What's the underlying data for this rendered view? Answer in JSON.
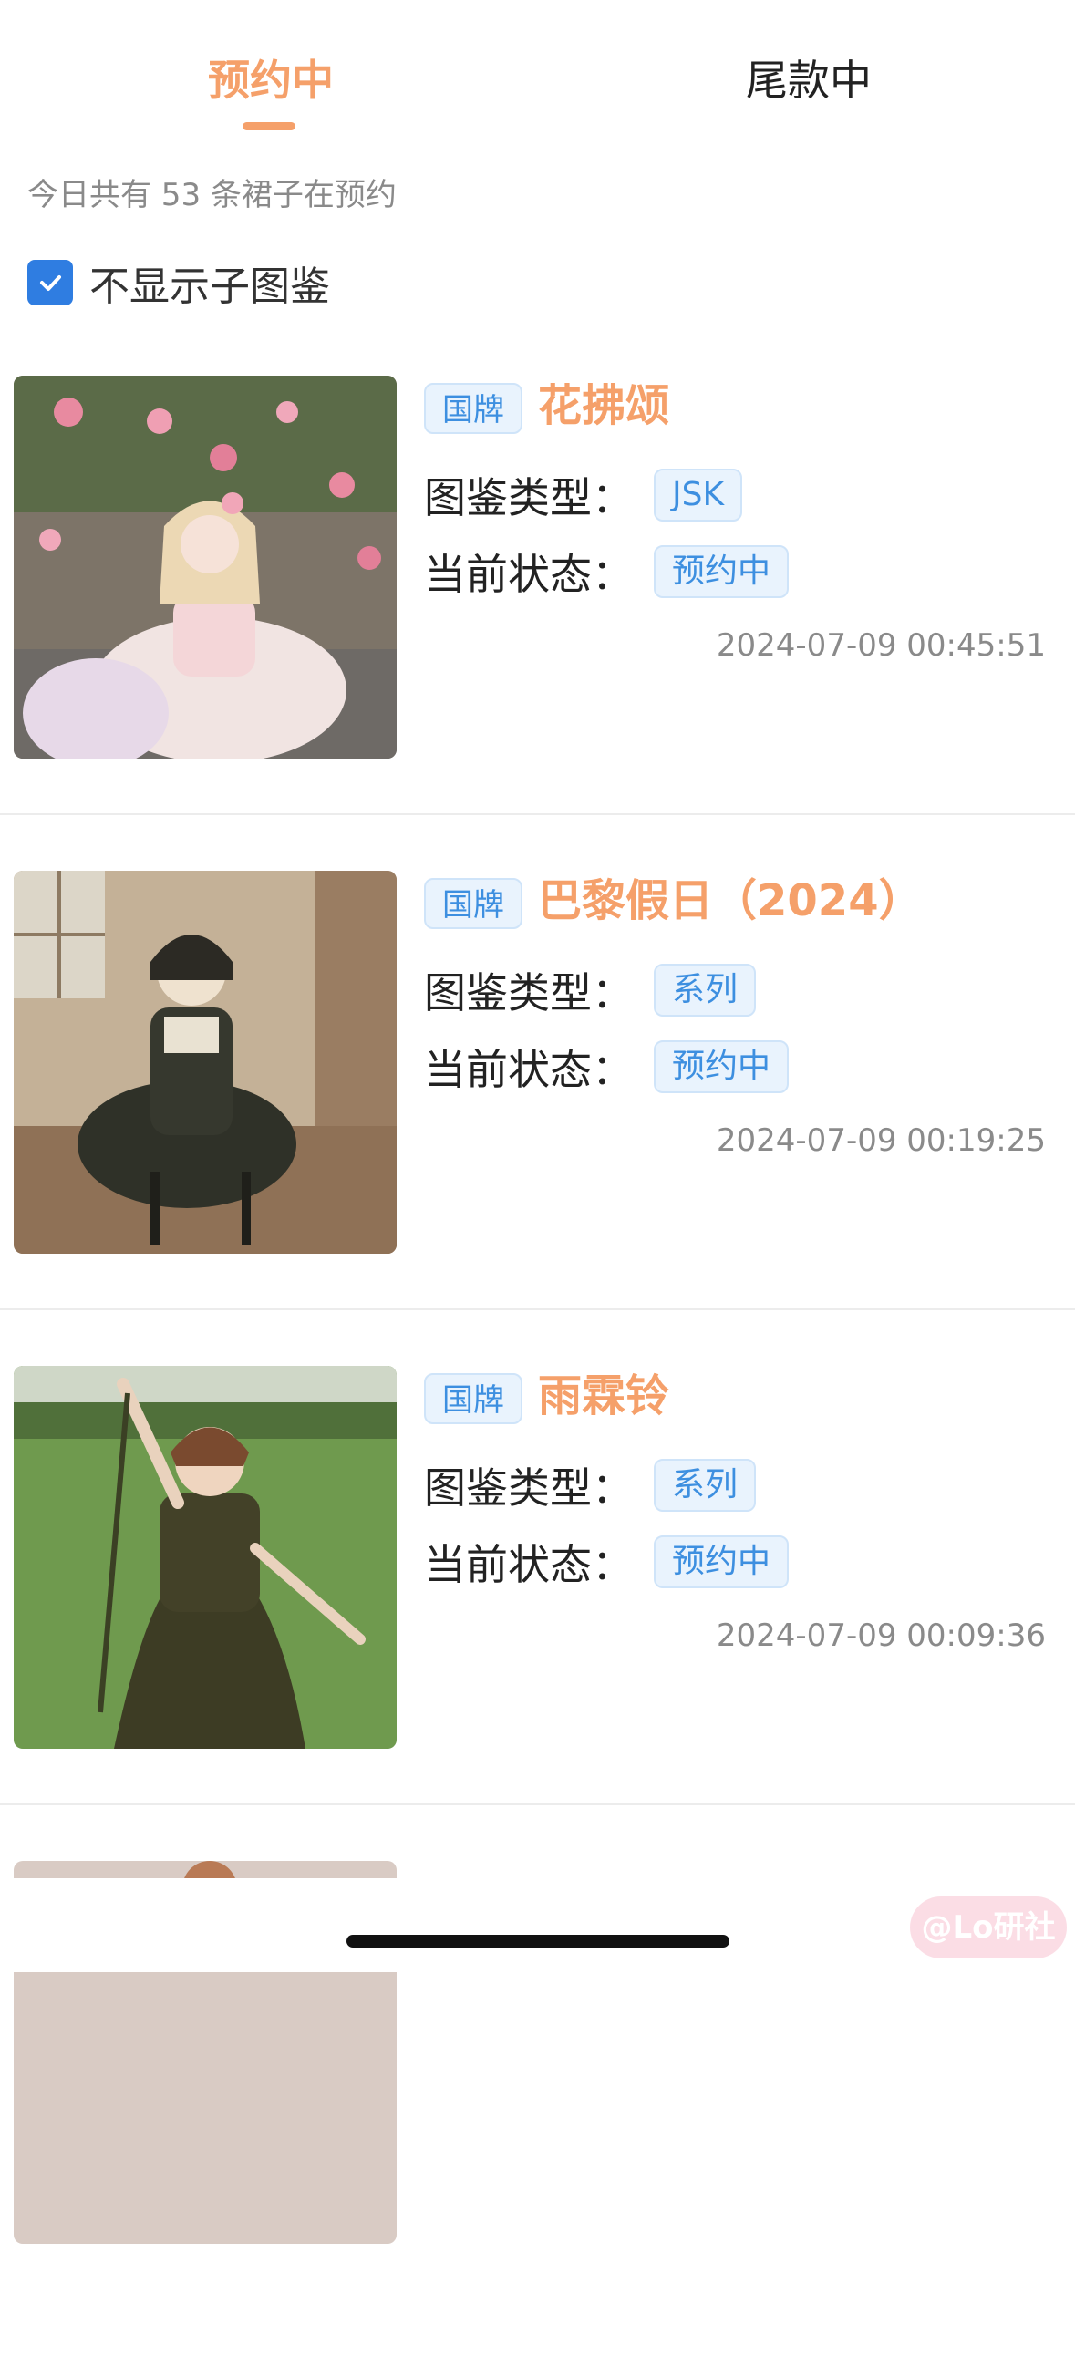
{
  "tabs": {
    "active_label": "预约中",
    "inactive_label": "尾款中"
  },
  "summary": "今日共有 53 条裙子在预约",
  "filter": {
    "checked": true,
    "label": "不显示子图鉴"
  },
  "items": [
    {
      "brand_tag": "国牌",
      "title": "花拂颂",
      "type_label": "图鉴类型：",
      "type_value": "JSK",
      "status_label": "当前状态：",
      "status_value": "预约中",
      "time": "2024-07-09 00:45:51",
      "photo": "dress-photo-pink-roses"
    },
    {
      "brand_tag": "国牌",
      "title": "巴黎假日（2024）",
      "type_label": "图鉴类型：",
      "type_value": "系列",
      "status_label": "当前状态：",
      "status_value": "预约中",
      "time": "2024-07-09 00:19:25",
      "photo": "dress-photo-dark-room"
    },
    {
      "brand_tag": "国牌",
      "title": "雨霖铃",
      "type_label": "图鉴类型：",
      "type_value": "系列",
      "status_label": "当前状态：",
      "status_value": "预约中",
      "time": "2024-07-09 00:09:36",
      "photo": "dress-photo-green-lawn"
    }
  ],
  "watermark": "@Lo研社",
  "colors": {
    "accent": "#f5a06a",
    "tag_blue": "#3d8fe0",
    "tag_bg": "#e9f3fd",
    "checkbox": "#2f7de1"
  }
}
